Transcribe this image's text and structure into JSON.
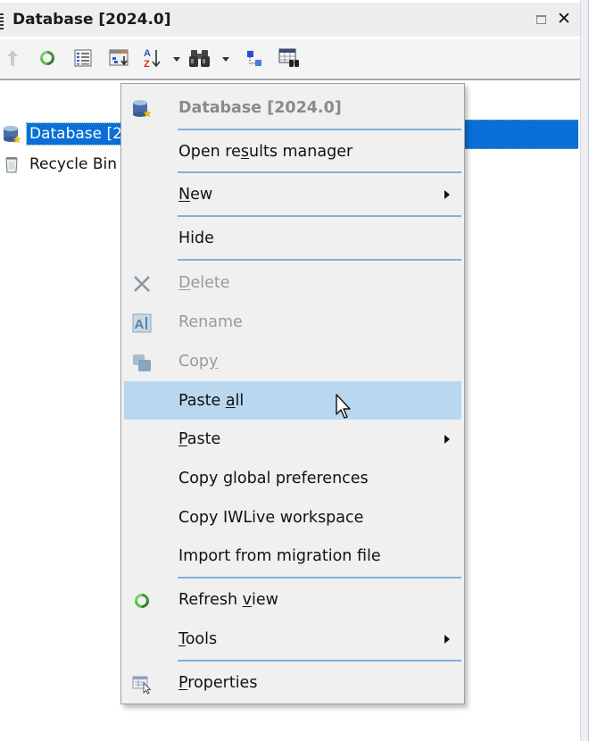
{
  "panel": {
    "title": "Database [2024.0]",
    "controls": {
      "maximize_icon": "maximize-icon",
      "close_icon": "close-icon"
    }
  },
  "toolbar": {
    "buttons": [
      {
        "name": "up-arrow-icon",
        "tooltip": "Up",
        "enabled": false
      },
      {
        "name": "refresh-icon",
        "tooltip": "Refresh"
      },
      {
        "name": "list-view-icon",
        "tooltip": "List view"
      },
      {
        "name": "sort-options-icon",
        "tooltip": "Sort options"
      },
      {
        "name": "sort-az-icon",
        "tooltip": "Sort A-Z",
        "has_dropdown": true
      },
      {
        "name": "binoculars-find-icon",
        "tooltip": "Find",
        "has_dropdown": true
      },
      {
        "name": "tree-hierarchy-icon",
        "tooltip": "Hierarchy"
      },
      {
        "name": "table-find-icon",
        "tooltip": "Find in table"
      }
    ]
  },
  "tree": {
    "items": [
      {
        "label": "Database [2024.0]",
        "visible_label": "Database [2",
        "icon": "database-icon",
        "selected": true
      },
      {
        "label": "Recycle Bin",
        "visible_label": "Recycle Bin",
        "icon": "recycle-bin-icon",
        "selected": false
      }
    ]
  },
  "context_menu": {
    "header": {
      "label": "Database [2024.0]",
      "icon": "database-icon"
    },
    "items": [
      {
        "pre": "Open re",
        "u": "s",
        "post": "ults manager",
        "enabled": true
      },
      {
        "pre": "",
        "u": "N",
        "post": "ew",
        "enabled": true,
        "submenu": true
      },
      {
        "pre": "Hide",
        "u": "",
        "post": "",
        "enabled": true
      },
      {
        "pre": "",
        "u": "D",
        "post": "elete",
        "enabled": false,
        "icon": "delete-x-icon"
      },
      {
        "pre": "Rename",
        "u": "",
        "post": "",
        "enabled": false,
        "icon": "rename-icon"
      },
      {
        "pre": "Cop",
        "u": "y",
        "post": "",
        "enabled": false,
        "icon": "copy-icon"
      },
      {
        "pre": "Paste ",
        "u": "a",
        "post": "ll",
        "enabled": true,
        "hovered": true
      },
      {
        "pre": "",
        "u": "P",
        "post": "aste",
        "enabled": true,
        "submenu": true
      },
      {
        "pre": "Copy global preferences",
        "u": "",
        "post": "",
        "enabled": true
      },
      {
        "pre": "Copy IWLive workspace",
        "u": "",
        "post": "",
        "enabled": true
      },
      {
        "pre": "Import from migration file",
        "u": "",
        "post": "",
        "enabled": true
      },
      {
        "pre": "Refresh ",
        "u": "v",
        "post": "iew",
        "enabled": true,
        "icon": "refresh-icon"
      },
      {
        "pre": "",
        "u": "T",
        "post": "ools",
        "enabled": true,
        "submenu": true
      },
      {
        "pre": "",
        "u": "P",
        "post": "roperties",
        "enabled": true,
        "icon": "properties-icon"
      }
    ]
  },
  "colors": {
    "selection": "#0a6fd6",
    "menu_hover": "#b9d8f0",
    "menu_separator": "#7fb1db",
    "menu_background": "#f0f0f0",
    "disabled_text": "#9a9a9a"
  }
}
